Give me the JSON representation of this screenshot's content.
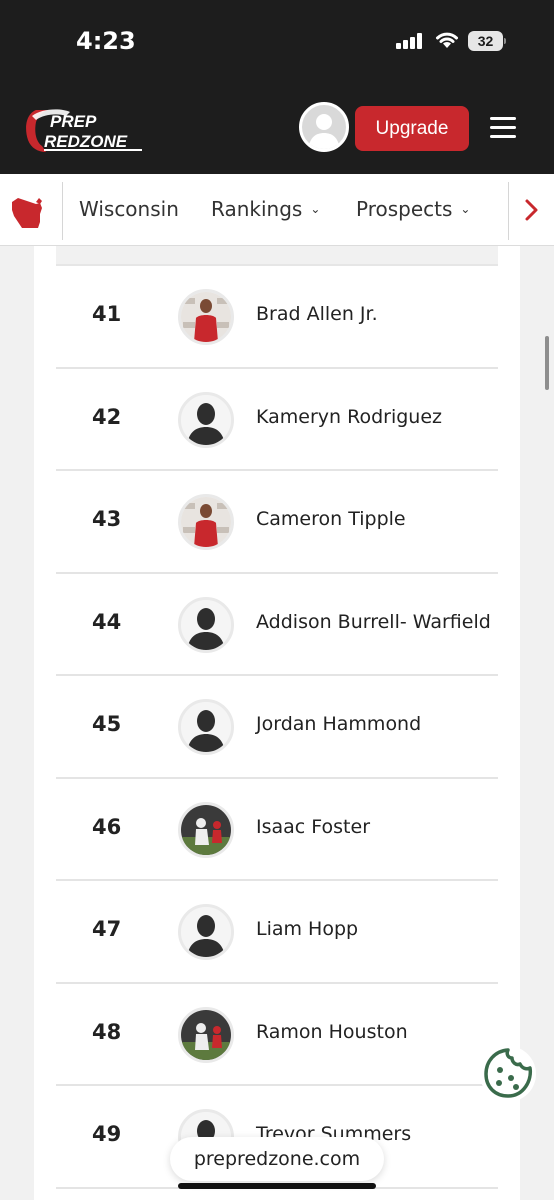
{
  "status_bar": {
    "time": "4:23",
    "battery": "32"
  },
  "header": {
    "logo_line1": "PREP",
    "logo_line2": "REDZONE",
    "upgrade_label": "Upgrade",
    "accent_color": "#c8282d"
  },
  "nav": {
    "state": "Wisconsin",
    "items": [
      {
        "label": "Rankings",
        "icon": "chevron-down-icon"
      },
      {
        "label": "Prospects",
        "icon": "chevron-down-icon"
      }
    ],
    "next_icon": "chevron-right-icon"
  },
  "rankings": [
    {
      "rank": "41",
      "name": "Brad Allen Jr.",
      "photo": "photo"
    },
    {
      "rank": "42",
      "name": "Kameryn Rodriguez",
      "photo": "placeholder"
    },
    {
      "rank": "43",
      "name": "Cameron Tipple",
      "photo": "photo"
    },
    {
      "rank": "44",
      "name": "Addison Burrell- Warfield",
      "photo": "placeholder"
    },
    {
      "rank": "45",
      "name": "Jordan Hammond",
      "photo": "placeholder"
    },
    {
      "rank": "46",
      "name": "Isaac Foster",
      "photo": "action-photo"
    },
    {
      "rank": "47",
      "name": "Liam Hopp",
      "photo": "placeholder"
    },
    {
      "rank": "48",
      "name": "Ramon Houston",
      "photo": "action-photo"
    },
    {
      "rank": "49",
      "name": "Trevor Summers",
      "photo": "placeholder"
    }
  ],
  "browser": {
    "url": "prepredzone.com"
  }
}
